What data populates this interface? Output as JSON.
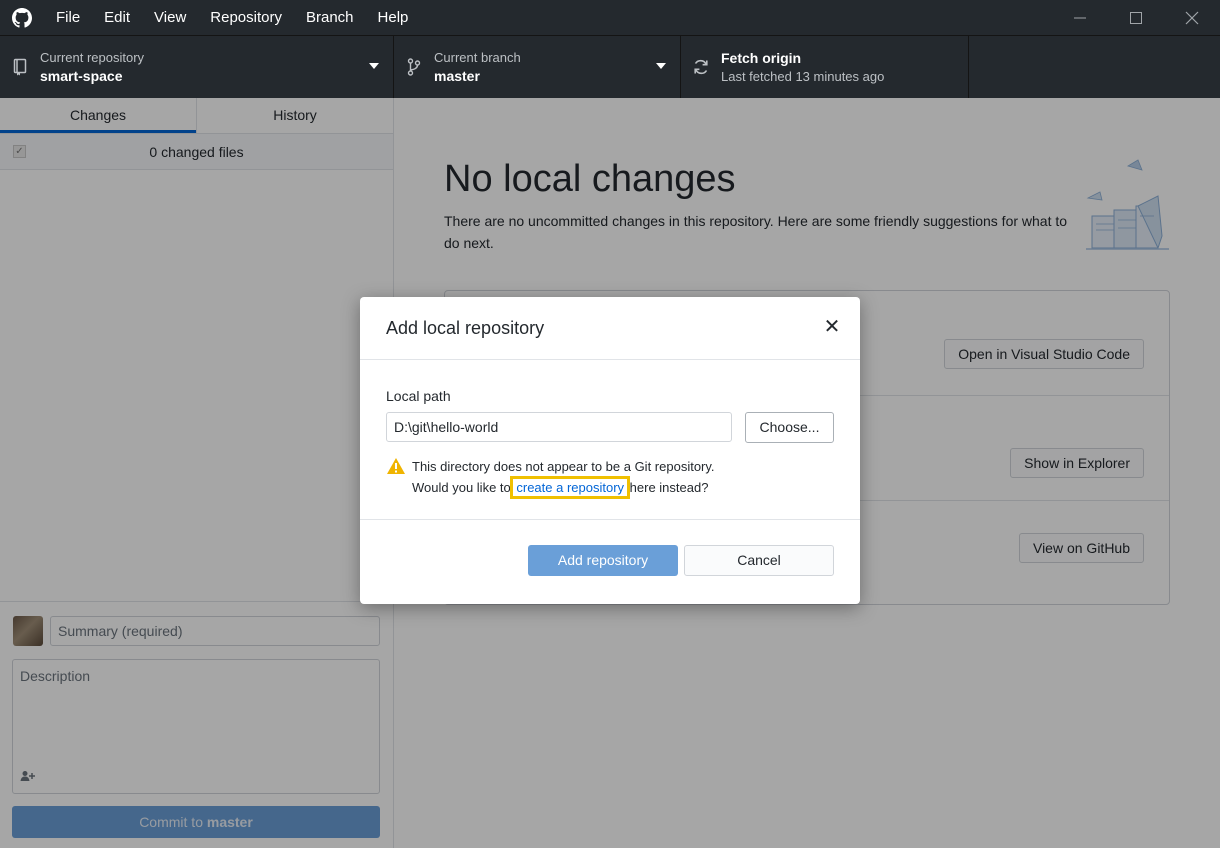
{
  "menu": [
    "File",
    "Edit",
    "View",
    "Repository",
    "Branch",
    "Help"
  ],
  "window_controls": [
    "minimize-icon",
    "maximize-icon",
    "close-icon"
  ],
  "toolbar": {
    "repo": {
      "label": "Current repository",
      "value": "smart-space"
    },
    "branch": {
      "label": "Current branch",
      "value": "master"
    },
    "fetch": {
      "label": "Fetch origin",
      "sub": "Last fetched 13 minutes ago"
    }
  },
  "sidebar": {
    "tabs": [
      {
        "label": "Changes",
        "active": true
      },
      {
        "label": "History",
        "active": false
      }
    ],
    "changed_files": "0 changed files",
    "summary_placeholder": "Summary (required)",
    "description_placeholder": "Description",
    "commit_prefix": "Commit to ",
    "commit_branch": "master"
  },
  "main": {
    "title": "No local changes",
    "description": "There are no uncommitted changes in this repository. Here are some friendly suggestions for what to do next.",
    "suggestions": [
      "Open in Visual Studio Code",
      "Show in Explorer",
      "View on GitHub"
    ]
  },
  "dialog": {
    "title": "Add local repository",
    "local_path_label": "Local path",
    "local_path_value": "D:\\git\\hello-world",
    "choose_label": "Choose...",
    "warning_line1": "This directory does not appear to be a Git repository.",
    "warning_prefix": "Would you like to ",
    "warning_link": "create a repository",
    "warning_suffix": " here instead?",
    "add_label": "Add repository",
    "cancel_label": "Cancel"
  },
  "colors": {
    "titlebar": "#24292e",
    "accent": "#0366d6",
    "primary_button_disabled": "#6a9fd8",
    "highlight": "#f0c000",
    "warning": "#f0b400"
  }
}
